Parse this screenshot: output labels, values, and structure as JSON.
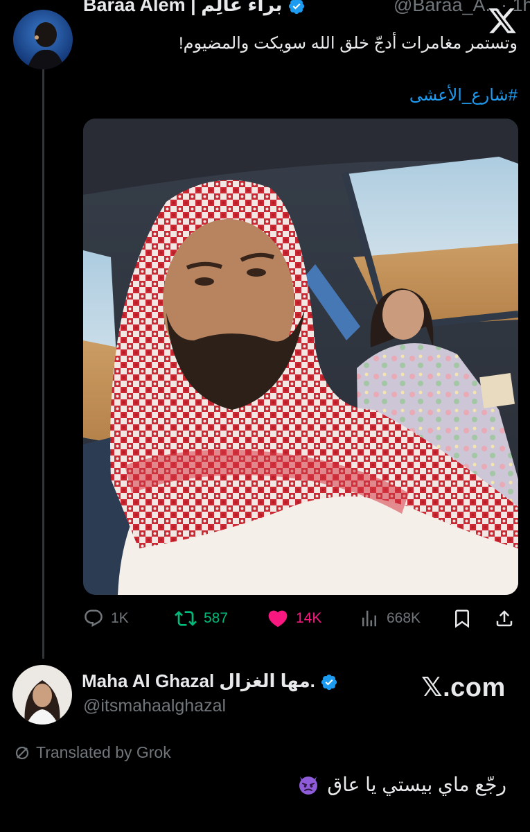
{
  "tweet": {
    "author_name": "Baraa Alem | براء عالِم",
    "handle_time": "@Baraa_A...· 1h",
    "text": "وتستمر مغامرات أدجّ خلق الله سويكت والمضيوم!",
    "hashtag": "#شارع_الأعشى",
    "image_alt": "Selfie in a car: man in red-white shemagh, woman in floral dress in passenger seat, desert outside",
    "stats": {
      "replies": "1K",
      "reposts": "587",
      "likes": "14K",
      "views": "668K"
    }
  },
  "reply": {
    "author_name": "Maha Al Ghazal مها الغزال.",
    "handle": "@itsmahaalghazal",
    "translated_label": "Translated by Grok",
    "text": "رجّع ماي بيستي يا عاق"
  },
  "watermark": "𝕏.com",
  "colors": {
    "background": "#000000",
    "text": "#e7e9ea",
    "muted": "#71767b",
    "link": "#1d9bf0",
    "repost": "#00ba7c",
    "like": "#f91880"
  },
  "icons": [
    "x-logo-icon",
    "verified-badge-icon",
    "reply-icon",
    "repost-icon",
    "like-icon",
    "views-icon",
    "bookmark-icon",
    "share-icon",
    "grok-icon",
    "devil-emoji-icon"
  ]
}
